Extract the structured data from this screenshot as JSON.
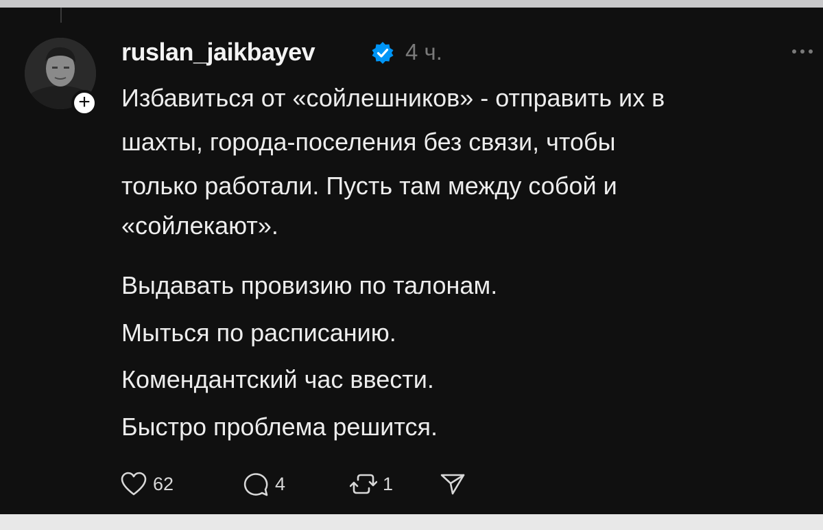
{
  "post": {
    "username": "ruslan_jaikbayev",
    "time": "4 ч.",
    "paragraph1": [
      "Избавиться от «сойлешников» - отправить их в",
      "шахты, города-поселения без связи, чтобы",
      "только работали. Пусть там между собой и",
      "«сойлекают»."
    ],
    "paragraph2": [
      "Выдавать провизию по талонам.",
      "Мыться по расписанию.",
      "Комендантский час ввести.",
      "Быстро проблема решится."
    ]
  },
  "actions": {
    "likes": "62",
    "replies": "4",
    "reposts": "1"
  },
  "icons": {
    "avatar": "avatar",
    "follow": "plus-icon",
    "verified": "verified-badge-icon",
    "more": "more-options-icon",
    "like": "heart-icon",
    "reply": "comment-icon",
    "repost": "repost-icon",
    "share": "send-icon"
  },
  "colors": {
    "background": "#101010",
    "text": "#ededed",
    "muted": "#7a7a7a",
    "verified": "#0095f6"
  }
}
